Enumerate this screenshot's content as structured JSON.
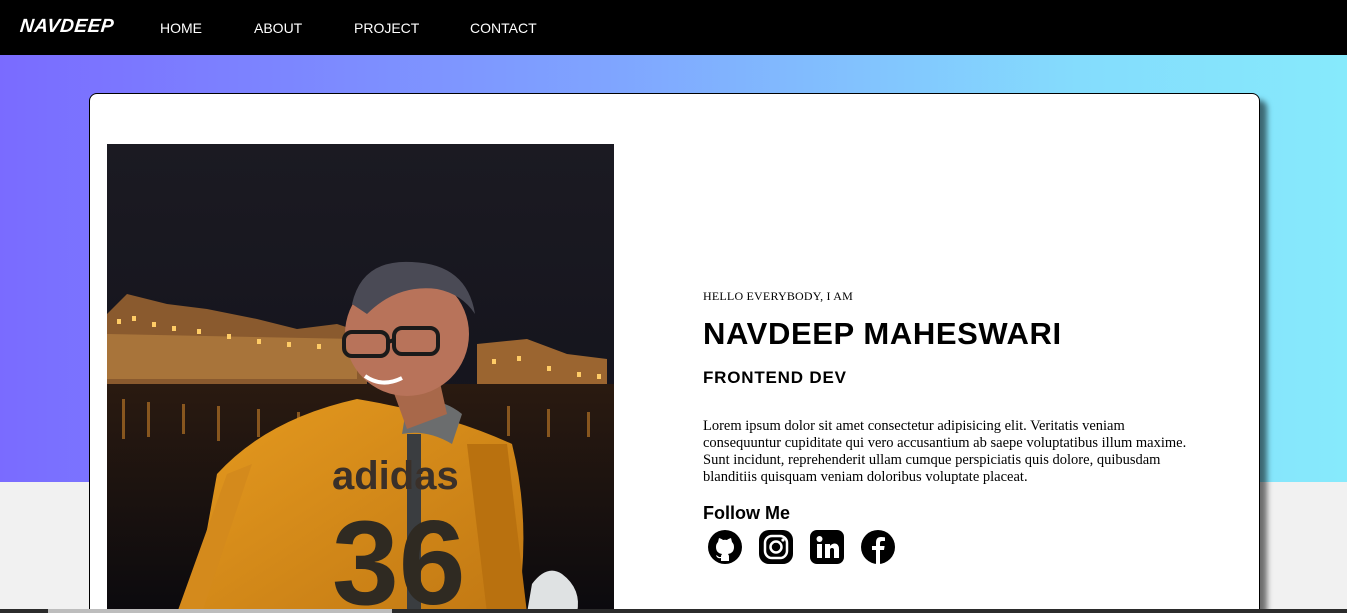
{
  "nav": {
    "logo": "NAVDEEP",
    "links": [
      {
        "label": "HOME"
      },
      {
        "label": "ABOUT"
      },
      {
        "label": "PROJECT"
      },
      {
        "label": "CONTACT"
      }
    ]
  },
  "hero": {
    "intro": "HELLO EVERYBODY, I AM",
    "name": "NAVDEEP MAHESWARI",
    "role": "FRONTEND DEV",
    "bio": "Lorem ipsum dolor sit amet consectetur adipisicing elit. Veritatis veniam consequuntur cupiditate qui vero accusantium ab saepe voluptatibus illum maxime. Sunt incidunt, reprehenderit ullam cumque perspiciatis quis dolore, quibusdam blanditiis quisquam veniam doloribus voluptate placeat.",
    "follow_label": "Follow Me",
    "photo_shirt_text": "adidas",
    "photo_shirt_number": "36"
  },
  "socials": [
    {
      "icon": "github-icon"
    },
    {
      "icon": "instagram-icon"
    },
    {
      "icon": "linkedin-icon"
    },
    {
      "icon": "facebook-icon"
    }
  ],
  "colors": {
    "navbar": "#000000",
    "gradient_start": "#7a6bff",
    "gradient_end": "#86eafc",
    "card": "#ffffff"
  }
}
